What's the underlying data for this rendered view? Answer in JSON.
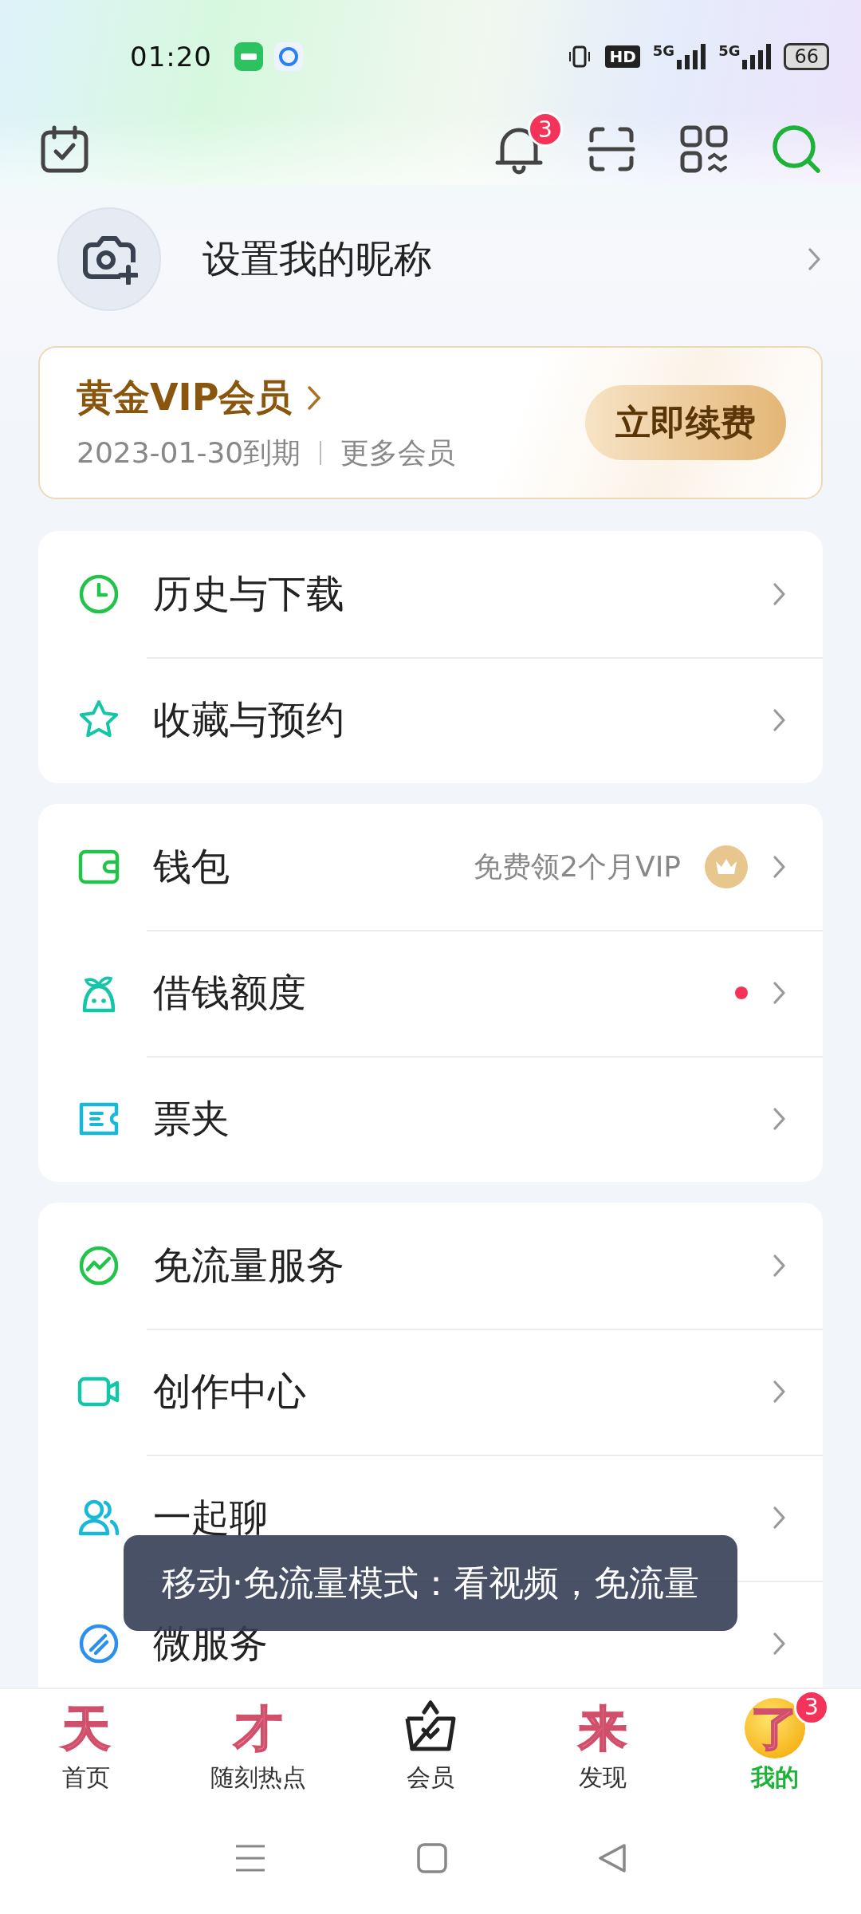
{
  "status_bar": {
    "time": "01:20",
    "hd_label": "HD",
    "network_labels": [
      "5G",
      "5G"
    ],
    "battery": "66"
  },
  "header": {
    "notification_badge": "3"
  },
  "profile": {
    "nickname_prompt": "设置我的昵称"
  },
  "vip_card": {
    "title": "黄金VIP会员",
    "expiry": "2023-01-30到期",
    "more_link": "更多会员",
    "renew_button": "立即续费"
  },
  "menu_groups": [
    {
      "items": [
        {
          "kind": "clock",
          "label": "历史与下载",
          "new_dot": false
        },
        {
          "kind": "star",
          "label": "收藏与预约",
          "new_dot": false
        }
      ]
    },
    {
      "items": [
        {
          "kind": "wallet",
          "label": "钱包",
          "hint": "免费领2个月VIP",
          "new_dot": false
        },
        {
          "kind": "sprout",
          "label": "借钱额度",
          "new_dot": true
        },
        {
          "kind": "ticket",
          "label": "票夹",
          "new_dot": false
        }
      ]
    },
    {
      "items": [
        {
          "kind": "trend",
          "label": "免流量服务",
          "new_dot": false
        },
        {
          "kind": "video",
          "label": "创作中心",
          "new_dot": false
        },
        {
          "kind": "people",
          "label": "一起聊",
          "new_dot": false
        },
        {
          "kind": "service",
          "label": "微服务",
          "new_dot": false
        }
      ]
    }
  ],
  "toast": "移动·免流量模式：看视频，免流量",
  "bottom_nav": [
    {
      "label": "首页",
      "icon_text": "天",
      "selected": false
    },
    {
      "label": "随刻热点",
      "icon_text": "才",
      "selected": false
    },
    {
      "label": "会员",
      "selected": false
    },
    {
      "label": "发现",
      "icon_text": "来",
      "selected": false
    },
    {
      "label": "我的",
      "icon_text": "了",
      "selected": true,
      "badge": "3"
    }
  ]
}
